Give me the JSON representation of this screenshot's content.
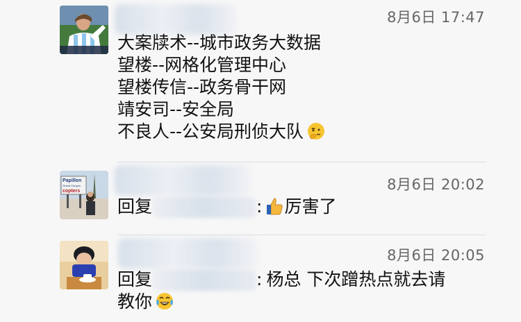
{
  "comments": [
    {
      "time": "8月6日 17:47",
      "lines": [
        "大案牍术--城市政务大数据",
        "望楼--网格化管理中心",
        "望楼传信--政务骨干网",
        "靖安司--安全局",
        "不良人--公安局刑侦大队"
      ],
      "emoji": "thinking-face-icon"
    },
    {
      "time": "8月6日 20:02",
      "reply_prefix": "回复",
      "reply_sep": ":",
      "text": "厉害了",
      "emoji": "thumbs-up-icon",
      "avatar_sign_text": [
        "Papillon",
        "Grand Canyon",
        "copters"
      ]
    },
    {
      "time": "8月6日 20:05",
      "reply_prefix": "回复",
      "reply_sep": ":",
      "text_line1": "杨总 下次蹭热点就去请",
      "text_line2": "教你",
      "emoji": "tears-of-joy-icon"
    }
  ]
}
